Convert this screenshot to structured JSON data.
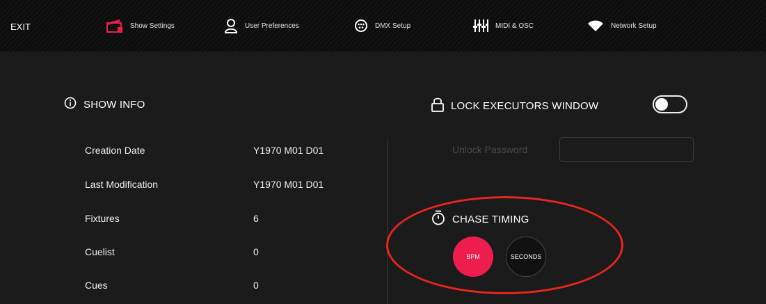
{
  "nav": {
    "exit_label": "EXIT",
    "tabs": [
      {
        "label": "Show Settings",
        "icon": "show-settings-icon"
      },
      {
        "label": "User Preferences",
        "icon": "user-icon"
      },
      {
        "label": "DMX Setup",
        "icon": "dmx-connector-icon"
      },
      {
        "label": "MIDI & OSC",
        "icon": "sliders-icon"
      },
      {
        "label": "Network Setup",
        "icon": "wifi-icon"
      }
    ],
    "active_tab": "Show Settings",
    "accent_color": "#ee1d4d"
  },
  "show_info": {
    "title": "SHOW INFO",
    "rows": [
      {
        "label": "Creation Date",
        "value": "Y1970 M01 D01"
      },
      {
        "label": "Last Modification",
        "value": "Y1970 M01 D01"
      },
      {
        "label": "Fixtures",
        "value": "6"
      },
      {
        "label": "Cuelist",
        "value": "0"
      },
      {
        "label": "Cues",
        "value": "0"
      }
    ]
  },
  "lock": {
    "title": "LOCK EXECUTORS WINDOW",
    "toggle_on": false,
    "unlock_label": "Unlock Password",
    "unlock_value": ""
  },
  "chase": {
    "title": "CHASE TIMING",
    "options": [
      "BPM",
      "SECONDS"
    ],
    "selected": "BPM"
  },
  "annotation": {
    "color": "#e8261e"
  }
}
